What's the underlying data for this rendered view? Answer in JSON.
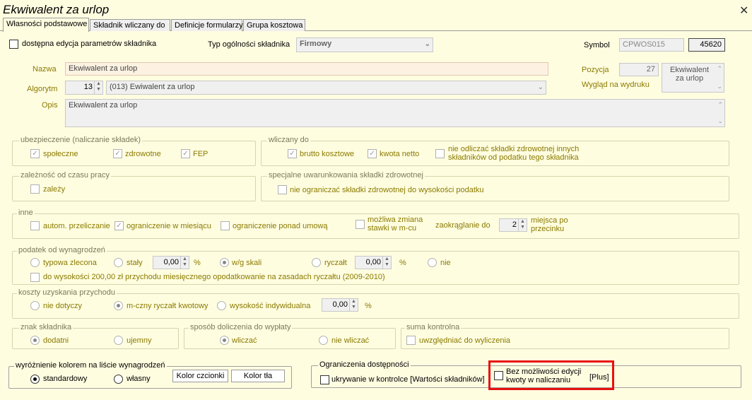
{
  "window": {
    "title": "Ekwiwalent za urlop",
    "close_glyph": "✕"
  },
  "tabs": [
    "Własności podstawowe",
    "Składnik wliczany do",
    "Definicje formularzy",
    "Grupa kosztowa"
  ],
  "top": {
    "editable_label": "dostępna edycja parametrów składnika",
    "typ_label": "Typ ogólności składnika",
    "typ_value": "Firmowy",
    "symbol_label": "Symbol",
    "symbol_value": "CPWOS015",
    "symbol_number": "45620"
  },
  "main": {
    "nazwa_label": "Nazwa",
    "nazwa_value": "Ekwiwalent za urlop",
    "algorytm_label": "Algorytm",
    "algorytm_number": "13",
    "algorytm_value": "(013) Ewiwalent za urlop",
    "opis_label": "Opis",
    "opis_value": "Ekwiwalent za urlop",
    "pozycja_label": "Pozycja",
    "pozycja_value": "27",
    "wyglad_label": "Wygląd na wydruku",
    "wyglad_value_line1": "Ekwiwalent",
    "wyglad_value_line2": "za urlop"
  },
  "ubezpieczenie": {
    "title": "ubezpieczenie (naliczanie składek)",
    "spoleczne": "społeczne",
    "zdrowotne": "zdrowotne",
    "fep": "FEP"
  },
  "wliczany": {
    "title": "wliczany do",
    "brutto": "brutto kosztowe",
    "netto": "kwota netto",
    "nie_odliczac_line1": "nie odliczać składki zdrowotnej innych",
    "nie_odliczac_line2": "składników od podatku tego składnika"
  },
  "zaleznosc": {
    "title": "zależność od czasu pracy",
    "zalezy": "zależy"
  },
  "specjalne": {
    "title": "specjalne uwarunkowania składki zdrowotnej",
    "nie_ograniczac": "nie ograniczać składki zdrowotnej do wysokości podatku"
  },
  "inne": {
    "title": "inne",
    "autom": "autom. przeliczanie",
    "ograniczenie_miesiac": "ograniczenie w miesiącu",
    "ograniczenie_ponad": "ograniczenie ponad umową",
    "mozliwa_line1": "możliwa zmiana",
    "mozliwa_line2": "stawki w m-cu",
    "zaokraglanie": "zaokrąglanie do",
    "zaokraglanie_value": "2",
    "miejsca_line1": "miejsca po",
    "miejsca_line2": "przecinku"
  },
  "podatek": {
    "title": "podatek od wynagrodzeń",
    "typowa": "typowa zlecona",
    "staly": "stały",
    "staly_value": "0,00",
    "percent": "%",
    "wg_skali": "w/g skali",
    "ryczalt": "ryczałt",
    "ryczalt_value": "0,00",
    "nie": "nie",
    "do_wysokosci": "do wysokości 200,00 zł przychodu miesięcznego opodatkowanie na zasadach ryczałtu (2009-2010)"
  },
  "koszty": {
    "title": "koszty uzyskania przychodu",
    "nie_dotyczy": "nie dotyczy",
    "mczny": "m-czny ryczałt kwotowy",
    "wysokosc": "wysokość indywidualna",
    "value": "0,00",
    "percent": "%"
  },
  "znak": {
    "title": "znak składnika",
    "dodatni": "dodatni",
    "ujemny": "ujemny"
  },
  "sposob": {
    "title": "sposób doliczenia do wypłaty",
    "wliczac": "wliczać",
    "nie_wliczac": "nie wliczać"
  },
  "suma": {
    "title": "suma kontrolna",
    "uwzgledniac": "uwzględniać do wyliczenia"
  },
  "wyroznienie": {
    "title": "wyróżnienie kolorem na liście wynagrodzeń",
    "standardowy": "standardowy",
    "wlasny": "własny",
    "kolor_czcionki": "Kolor czcionki",
    "kolor_tla": "Kolor tła"
  },
  "ograniczenia": {
    "title": "Ograniczenia dostępności",
    "ukrywanie": "ukrywanie w kontrolce [Wartości składników]",
    "bez_line1": "Bez możliwości edycji",
    "bez_line2": "kwoty w naliczaniu",
    "plus": "[Plus]"
  },
  "colors": {
    "background": "#fffde0",
    "label_olive": "#8a7a00",
    "highlight": "#e81010"
  }
}
